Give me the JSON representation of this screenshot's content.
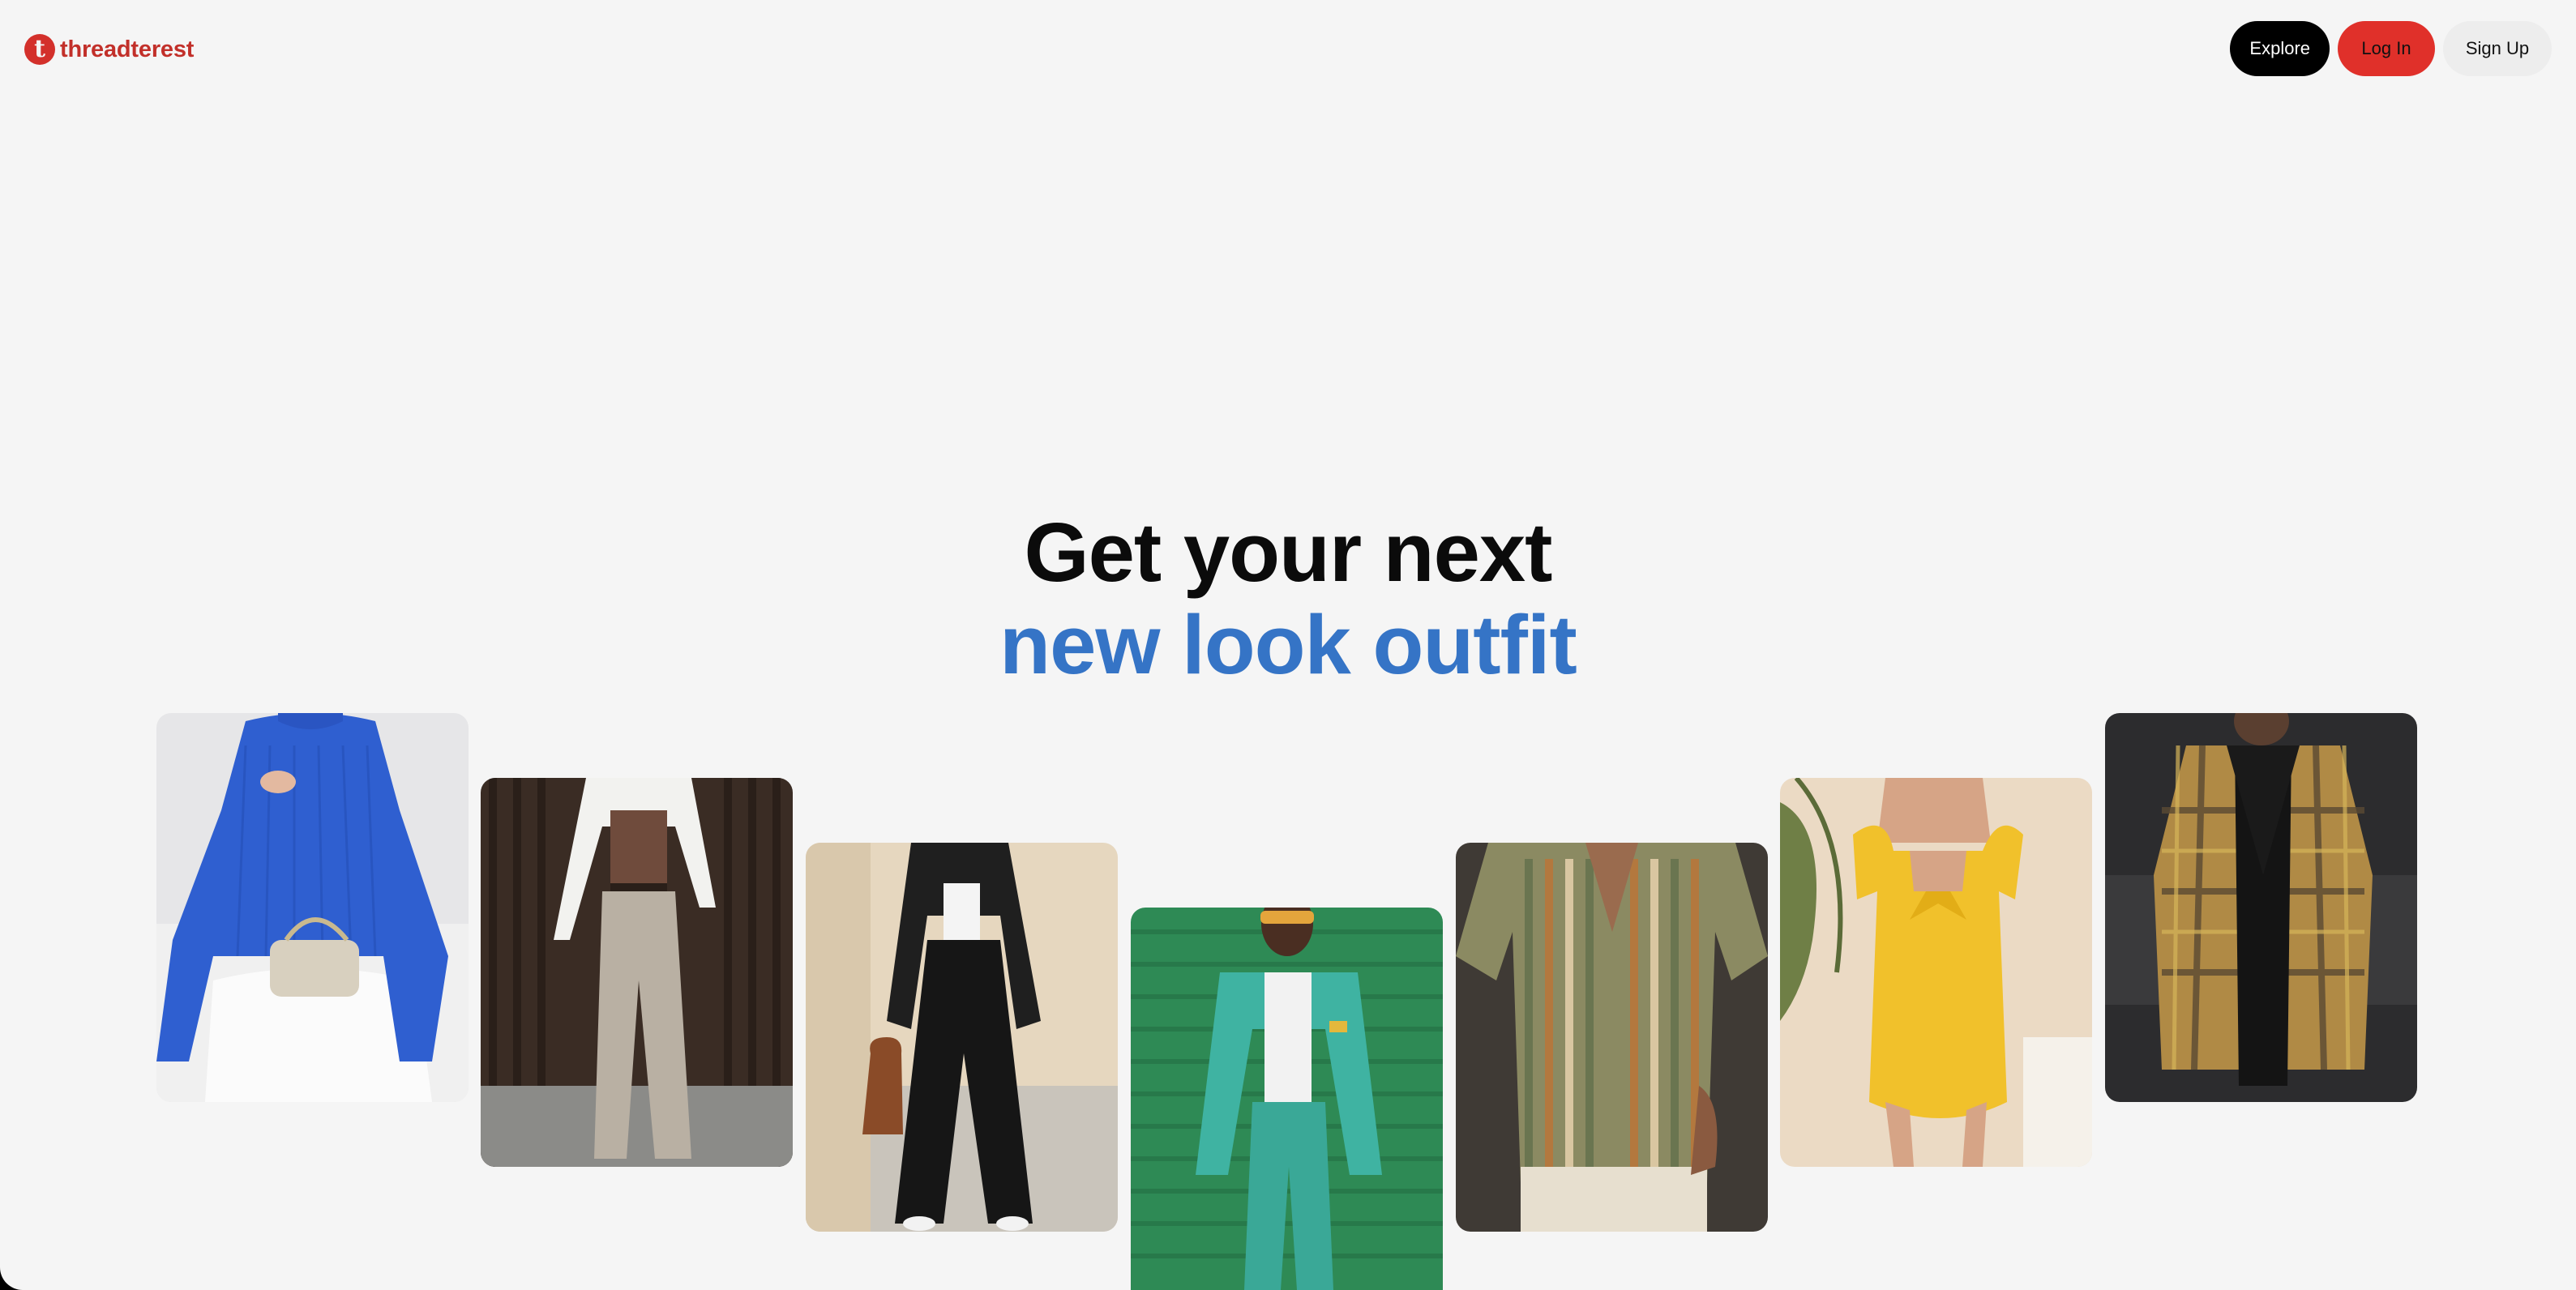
{
  "brand": {
    "logo_glyph": "t",
    "name": "threadterest",
    "color": "#c2302a"
  },
  "nav": {
    "explore_label": "Explore",
    "login_label": "Log In",
    "signup_label": "Sign Up"
  },
  "hero": {
    "line1": "Get your next",
    "line2": "new look outfit",
    "line2_color": "#3574c6"
  },
  "outfits": [
    {
      "label": "blue ribbed sweater with white jeans and quilted bag"
    },
    {
      "label": "white shirt over brown top with beige wide-leg trousers"
    },
    {
      "label": "black cropped shirt and wide pants with brown bag"
    },
    {
      "label": "teal suit with white tee and sunglasses on green wall"
    },
    {
      "label": "striped knit short-sleeve shirt with cream pants"
    },
    {
      "label": "yellow puff-sleeve dress with back bow"
    },
    {
      "label": "plaid yellow overcoat with black turtleneck"
    }
  ],
  "colors": {
    "background": "#f5f5f5",
    "explore_bg": "#000000",
    "login_bg": "#e0302a",
    "signup_bg": "#ededed"
  }
}
